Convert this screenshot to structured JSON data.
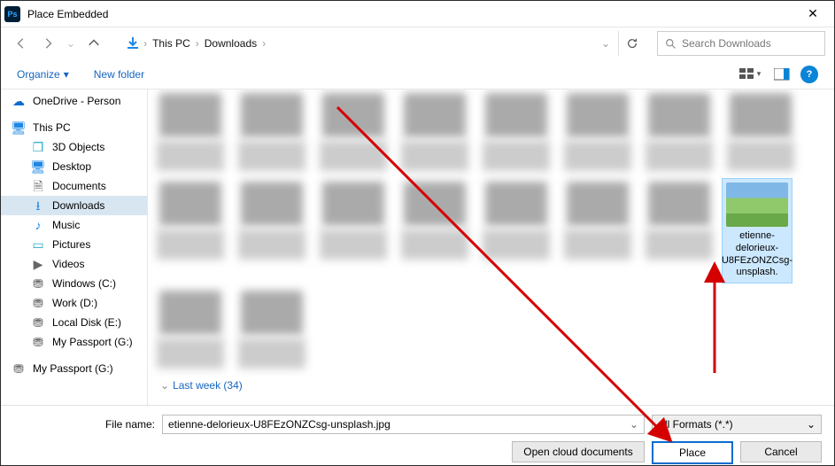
{
  "title": "Place Embedded",
  "breadcrumb": {
    "root": "This PC",
    "current": "Downloads"
  },
  "search_placeholder": "Search Downloads",
  "toolbar": {
    "organize": "Organize",
    "newfolder": "New folder"
  },
  "sidebar": {
    "onedrive": "OneDrive - Person",
    "thispc": "This PC",
    "items": [
      {
        "label": "3D Objects"
      },
      {
        "label": "Desktop"
      },
      {
        "label": "Documents"
      },
      {
        "label": "Downloads"
      },
      {
        "label": "Music"
      },
      {
        "label": "Pictures"
      },
      {
        "label": "Videos"
      },
      {
        "label": "Windows (C:)"
      },
      {
        "label": "Work (D:)"
      },
      {
        "label": "Local Disk (E:)"
      },
      {
        "label": "My Passport (G:)"
      },
      {
        "label": "My Passport (G:)"
      }
    ]
  },
  "selected_thumb": "etienne-delorieux-U8FEzONZCsg-unsplash.",
  "group_header": "Last week (34)",
  "footer": {
    "filename_label": "File name:",
    "filename_value": "etienne-delorieux-U8FEzONZCsg-unsplash.jpg",
    "format": "All Formats (*.*)",
    "open_cloud": "Open cloud documents",
    "place": "Place",
    "cancel": "Cancel"
  }
}
